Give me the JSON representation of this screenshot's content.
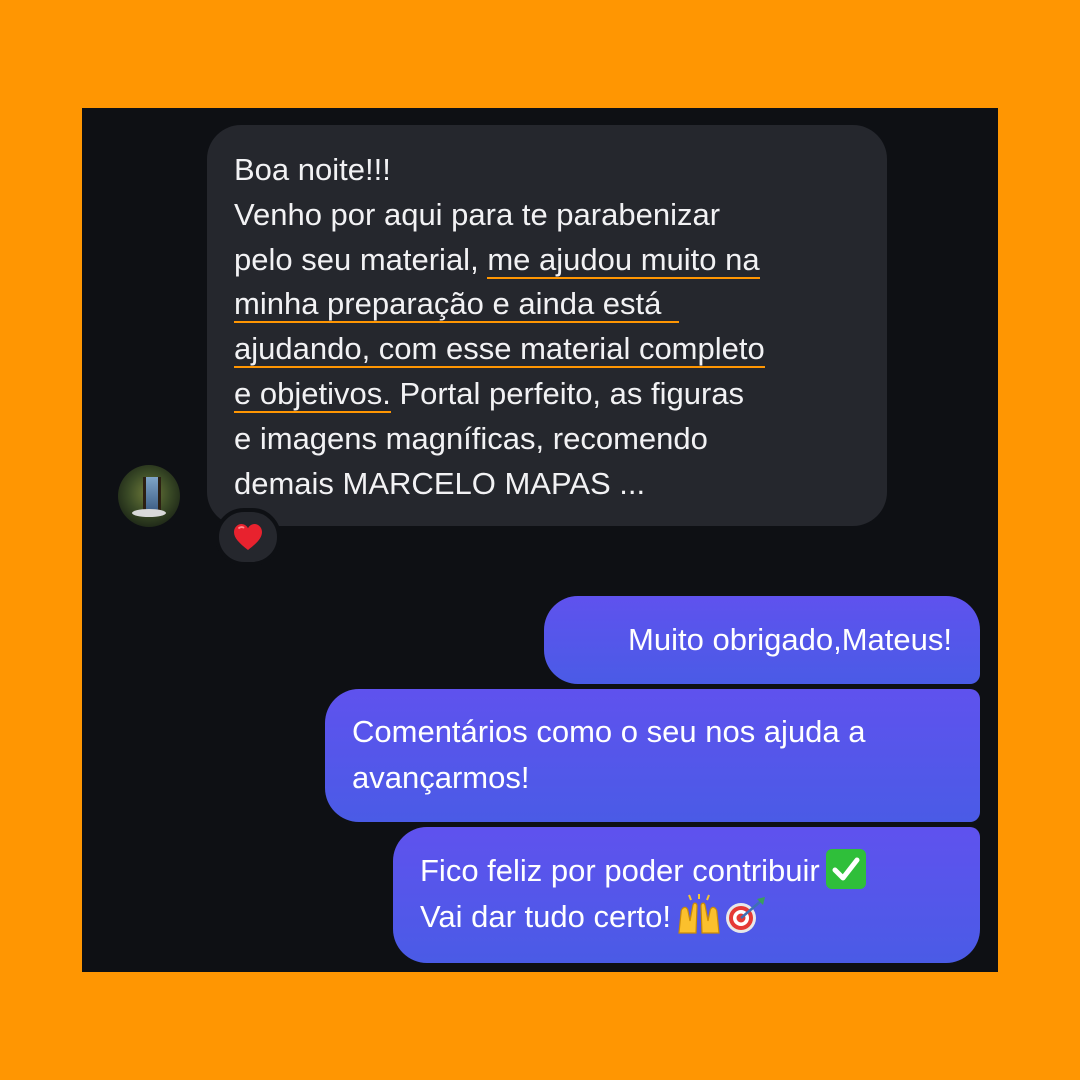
{
  "conversation": {
    "incoming": {
      "lines": [
        [
          {
            "text": "Boa noite!!!",
            "u": false
          }
        ],
        [
          {
            "text": "Venho por aqui para te parabenizar",
            "u": false
          }
        ],
        [
          {
            "text": "pelo seu material, ",
            "u": false
          },
          {
            "text": "me ajudou muito na",
            "u": true
          }
        ],
        [
          {
            "text": "minha preparação e ainda está  ",
            "u": true
          }
        ],
        [
          {
            "text": "ajudando, com esse material completo",
            "u": true
          }
        ],
        [
          {
            "text": "e objetivos.",
            "u": true
          },
          {
            "text": " Portal perfeito, as figuras",
            "u": false
          }
        ],
        [
          {
            "text": "e imagens magníficas, recomendo",
            "u": false
          }
        ],
        [
          {
            "text": "demais MARCELO MAPAS ...",
            "u": false
          }
        ]
      ],
      "reaction_icon": "red-heart-icon"
    },
    "outgoing": [
      {
        "lines": [
          "Muito obrigado,Mateus!"
        ]
      },
      {
        "lines": [
          "Comentários como o seu nos ajuda a",
          "avançarmos!"
        ]
      },
      {
        "line1": "Fico feliz por poder contribuir",
        "line1_icon": "check-mark-button-icon",
        "line2": "Vai dar tudo certo!",
        "line2_icons": [
          "raising-hands-icon",
          "direct-hit-icon"
        ]
      }
    ]
  },
  "colors": {
    "background": "#ff9602",
    "screen": "#0e1014",
    "incoming_bubble": "#25272d",
    "outgoing_bubble": "#5b55ec",
    "underline": "#ff9602"
  }
}
